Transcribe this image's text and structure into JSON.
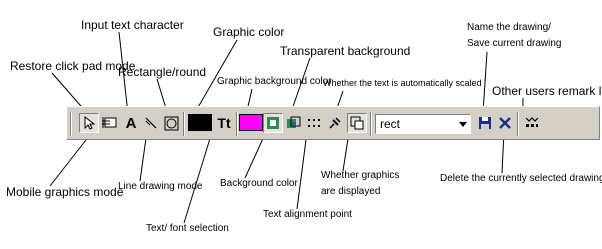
{
  "labels": {
    "input_text_character": "Input text character",
    "graphic_color": "Graphic color",
    "transparent_background": "Transparent background",
    "name_the_drawing": "Name the drawing/",
    "save_current_drawing": "Save current drawing",
    "restore_click_pad_mode": "Restore click pad mode",
    "rectangle_round": "Rectangle/round",
    "graphic_background_color": "Graphic background color",
    "whether_text_scaled": "Whether the text is automatically scaled",
    "other_users_remark_list": "Other users remark list",
    "mobile_graphics_mode": "Mobile graphics mode",
    "line_drawing_mode": "Line drawing mode",
    "background_color": "Background color",
    "whether_graphics_displayed_1": "Whether graphics",
    "whether_graphics_displayed_2": "are displayed",
    "delete_currently_selected": "Delete the currently selected drawing",
    "text_alignment_point": "Text alignment point",
    "text_font_selection": "Text/ font selection"
  },
  "toolbar": {
    "text_button_glyph": "A",
    "font_button_glyph": "Tt",
    "shape_combo_value": "rect",
    "graphic_color": "#000000",
    "background_color": "#ff00ff"
  }
}
